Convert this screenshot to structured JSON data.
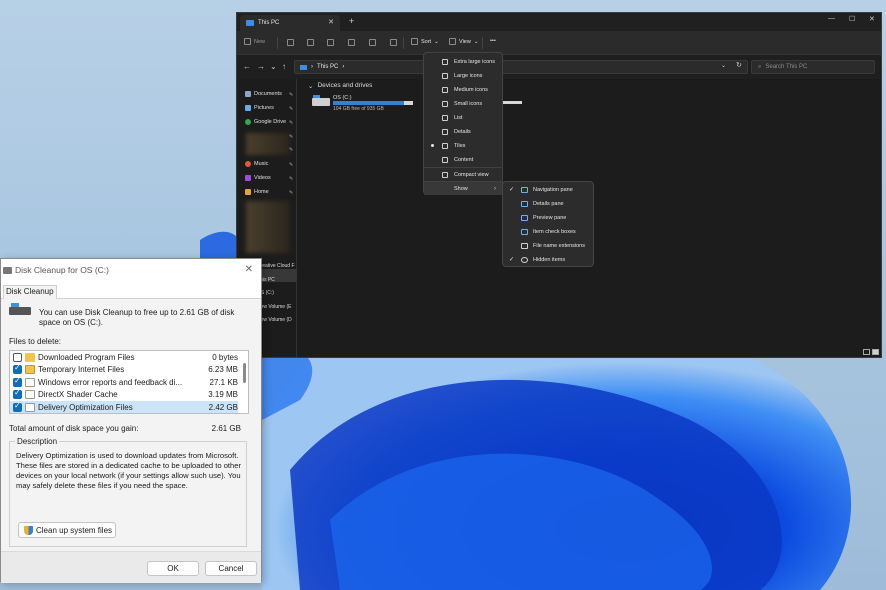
{
  "explorer": {
    "tab_title": "This PC",
    "new_tab": "+",
    "window_controls": {
      "minimize": "—",
      "maximize": "☐",
      "close": "✕"
    },
    "toolbar": {
      "new": "New",
      "sort": "Sort",
      "view": "View",
      "more": "•••"
    },
    "address": {
      "path": "This PC"
    },
    "search_placeholder": "Search This PC",
    "nav_items": [
      {
        "label": "Documents"
      },
      {
        "label": "Pictures"
      },
      {
        "label": "Google Drive"
      },
      {
        "label": "Music"
      },
      {
        "label": "Videos"
      },
      {
        "label": "Home"
      }
    ],
    "nav_lower": [
      "Creative Cloud F",
      "This PC",
      "OS (C:)",
      "New Volume (E",
      "New Volume (D"
    ],
    "group_title": "Devices and drives",
    "drive": {
      "name": "OS (C:)",
      "free": "104 GB free of 935 GB",
      "used_fraction": 0.89
    },
    "view_menu": [
      {
        "label": "Extra large icons"
      },
      {
        "label": "Large icons"
      },
      {
        "label": "Medium icons"
      },
      {
        "label": "Small icons"
      },
      {
        "label": "List"
      },
      {
        "label": "Details"
      },
      {
        "label": "Tiles"
      },
      {
        "label": "Content"
      },
      {
        "label": "Compact view"
      },
      {
        "label": "Show"
      }
    ],
    "show_menu": [
      {
        "label": "Navigation pane",
        "checked": true
      },
      {
        "label": "Details pane",
        "checked": false
      },
      {
        "label": "Preview pane",
        "checked": false
      },
      {
        "label": "Item check boxes",
        "checked": false
      },
      {
        "label": "File name extensions",
        "checked": false
      },
      {
        "label": "Hidden items",
        "checked": true
      }
    ]
  },
  "disk_cleanup": {
    "title": "Disk Cleanup for OS (C:)",
    "close": "✕",
    "tab": "Disk Cleanup",
    "intro": "You can use Disk Cleanup to free up to 2.61 GB of disk space on OS (C:).",
    "files_label": "Files to delete:",
    "files": [
      {
        "name": "Downloaded Program Files",
        "size": "0 bytes",
        "checked": false
      },
      {
        "name": "Temporary Internet Files",
        "size": "6.23 MB",
        "checked": true
      },
      {
        "name": "Windows error reports and feedback di...",
        "size": "27.1 KB",
        "checked": true
      },
      {
        "name": "DirectX Shader Cache",
        "size": "3.19 MB",
        "checked": true
      },
      {
        "name": "Delivery Optimization Files",
        "size": "2.42 GB",
        "checked": true
      }
    ],
    "total_label": "Total amount of disk space you gain:",
    "total_value": "2.61 GB",
    "description_title": "Description",
    "description_text": "Delivery Optimization is used to download updates from Microsoft. These files are stored in a dedicated cache to be uploaded to other devices on your local network (if your settings allow such use). You may safely delete these files if you need the space.",
    "system_button": "Clean up system files",
    "ok": "OK",
    "cancel": "Cancel"
  }
}
